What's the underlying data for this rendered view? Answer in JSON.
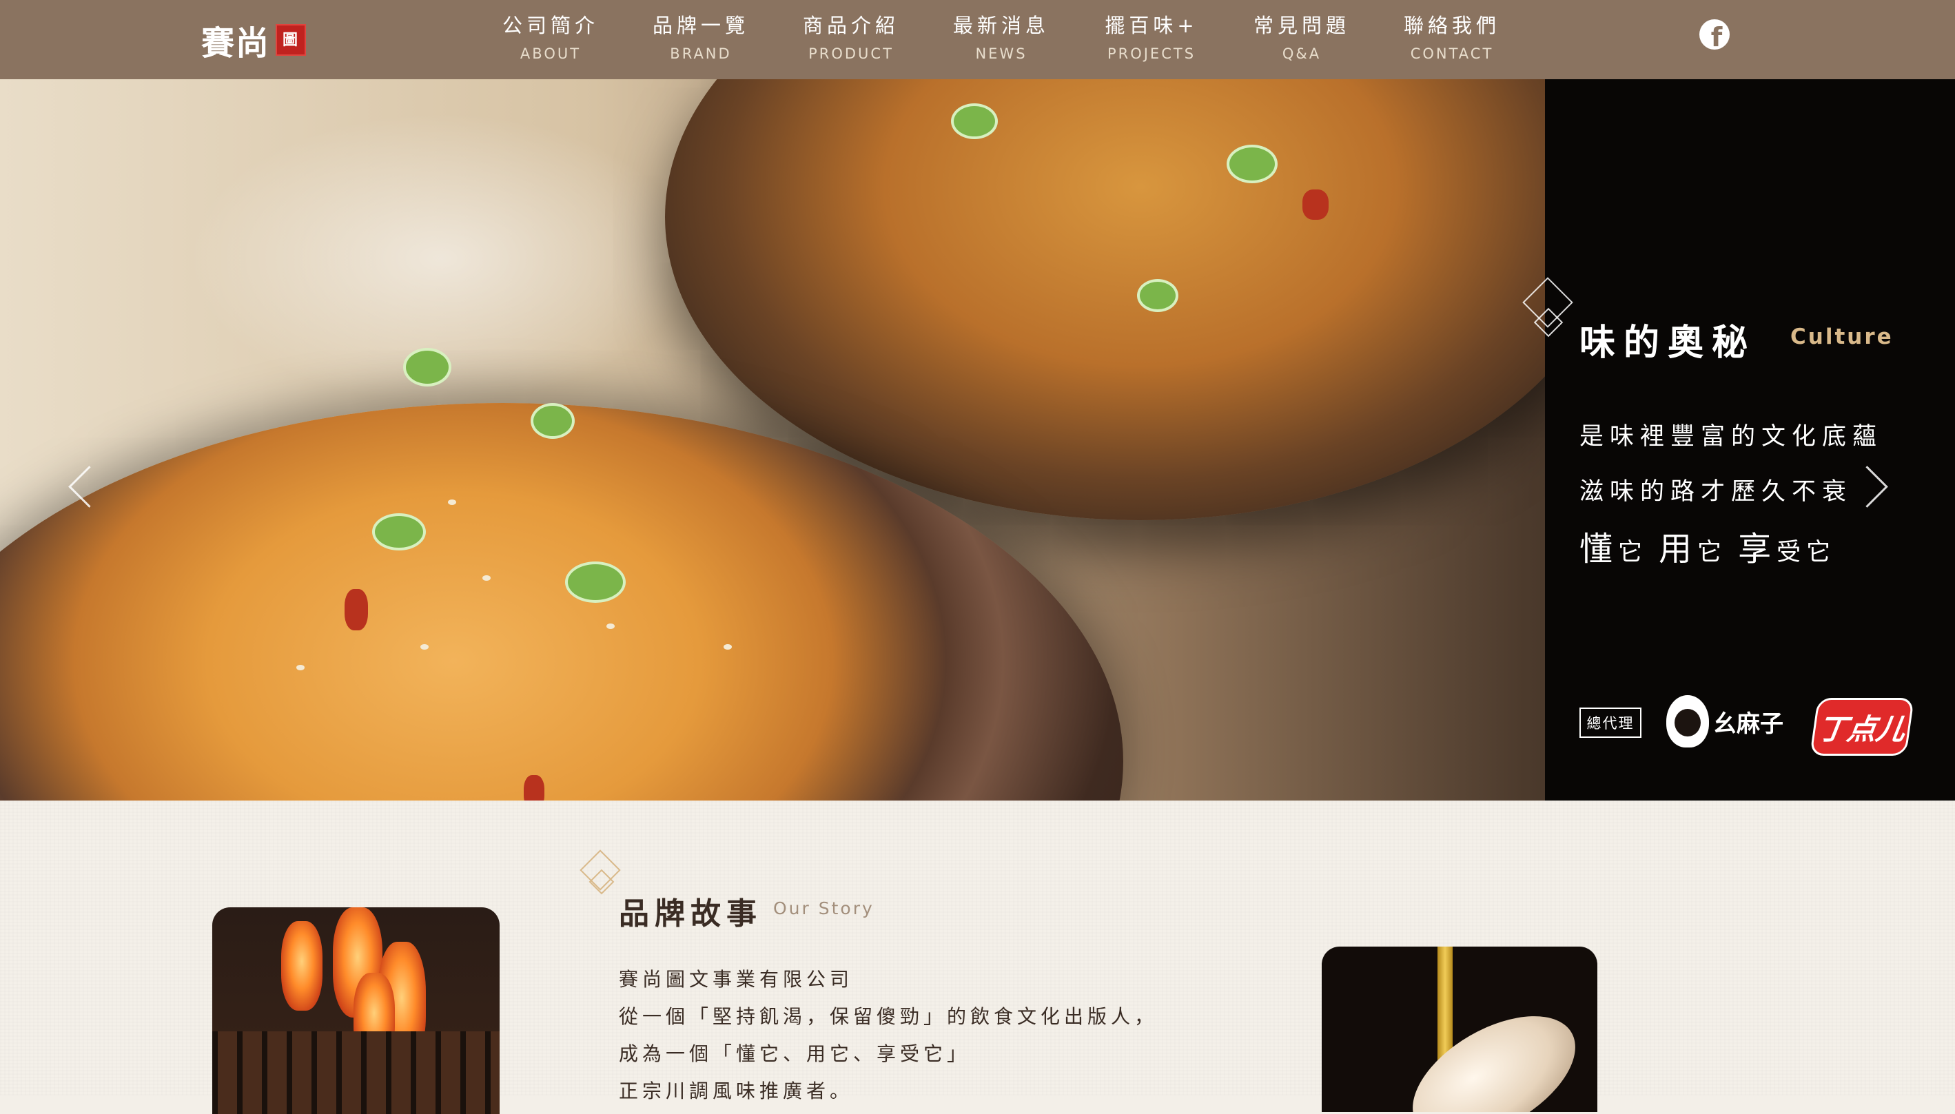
{
  "header": {
    "logo_text": "賽尚",
    "logo_seal": "圖",
    "nav": [
      {
        "zh": "公司簡介",
        "en": "ABOUT"
      },
      {
        "zh": "品牌一覽",
        "en": "BRAND"
      },
      {
        "zh": "商品介紹",
        "en": "PRODUCT"
      },
      {
        "zh": "最新消息",
        "en": "NEWS"
      },
      {
        "zh": "擺百味+",
        "en": "PROJECTS"
      },
      {
        "zh": "常見問題",
        "en": "Q&A"
      },
      {
        "zh": "聯絡我們",
        "en": "CONTACT"
      }
    ],
    "facebook_icon": "f"
  },
  "hero": {
    "title": "味的奧秘",
    "culture": "Culture",
    "line1": "是味裡豐富的文化底蘊",
    "line2": "滋味的路才歷久不衰",
    "line3_parts": [
      "懂",
      "它",
      "用",
      "它",
      "享",
      "受它"
    ],
    "agent_badge": "總代理",
    "brand1": "幺麻子",
    "brand2": "丁点儿"
  },
  "story": {
    "title": "品牌故事",
    "subtitle": "Our Story",
    "lines": [
      "賽尚圖文事業有限公司",
      "從一個「堅持飢渴，保留傻勁」的飲食文化出版人，",
      "成為一個「懂它、用它、享受它」",
      "正宗川調風味推廣者。"
    ]
  },
  "colors": {
    "header_bg": "#8a7360",
    "accent_gold": "#d9b98a",
    "panel_black": "#080605",
    "section_bg": "#f4f0e9"
  }
}
